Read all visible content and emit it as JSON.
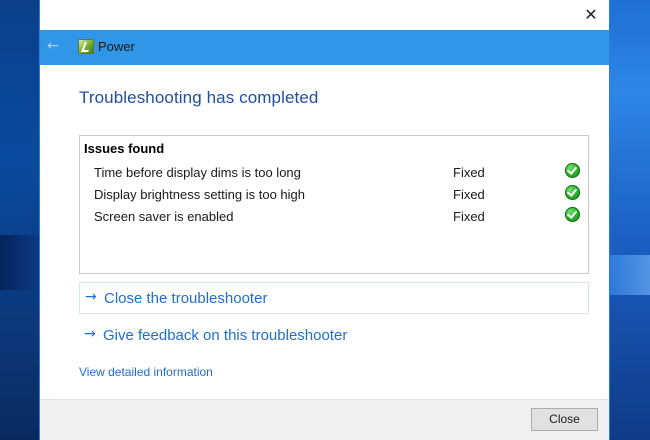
{
  "window": {
    "close_glyph": "✕"
  },
  "header": {
    "back_glyph": "←",
    "app_icon": "power-troubleshooter-icon",
    "title": "Power"
  },
  "main": {
    "title": "Troubleshooting has completed"
  },
  "issues": {
    "header": "Issues found",
    "rows": [
      {
        "description": "Time before display dims is too long",
        "status": "Fixed",
        "icon": "check-icon"
      },
      {
        "description": "Display brightness setting is too high",
        "status": "Fixed",
        "icon": "check-icon"
      },
      {
        "description": "Screen saver is enabled",
        "status": "Fixed",
        "icon": "check-icon"
      }
    ]
  },
  "actions": {
    "arrow_glyph": "→",
    "close_troubleshooter": "Close the troubleshooter",
    "give_feedback": "Give feedback on this troubleshooter"
  },
  "links": {
    "view_details": "View detailed information"
  },
  "footer": {
    "close_label": "Close"
  },
  "colors": {
    "header_bg": "#2f96e8",
    "title_color": "#1f4fa3",
    "link_color": "#1f6fd0",
    "check_green": "#2fb52f"
  }
}
